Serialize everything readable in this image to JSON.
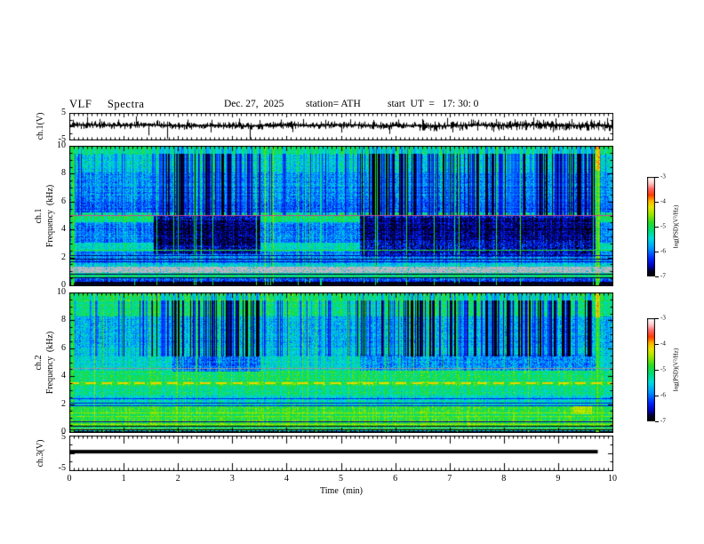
{
  "header": {
    "title": "VLF  Spectra",
    "date": "Dec. 27,  2025",
    "station": "station= ATH",
    "start_ut": "start  UT  =   17: 30: 0"
  },
  "axes": {
    "x_label": "Time  (min)",
    "x_ticks": [
      0,
      1,
      2,
      3,
      4,
      5,
      6,
      7,
      8,
      9,
      10
    ],
    "x_range": [
      0,
      10
    ],
    "wave_y_ticks": [
      5,
      -5
    ],
    "wave_y_range": [
      -5,
      5
    ],
    "spec_y_ticks": [
      10,
      8,
      6,
      4,
      2,
      0
    ],
    "spec_y_range": [
      0,
      10
    ],
    "ch1_wave_label": "ch.1(V)",
    "spec1_row_label": "ch.1",
    "spec2_row_label": "ch.2",
    "freq_label": "Frequency  (kHz)",
    "ch3_label": "ch.3(V)"
  },
  "colorbar": {
    "label": "log(PSD)(V²/Hz)",
    "ticks": [
      "-3",
      "-4",
      "-5",
      "-6",
      "-7"
    ],
    "range": [
      -3,
      -7
    ],
    "stops": [
      [
        0.0,
        "#000000"
      ],
      [
        0.05,
        "#000028"
      ],
      [
        0.1,
        "#0000b4"
      ],
      [
        0.18,
        "#0028ff"
      ],
      [
        0.28,
        "#0096ff"
      ],
      [
        0.38,
        "#00dcdc"
      ],
      [
        0.46,
        "#00dc78"
      ],
      [
        0.54,
        "#28dc28"
      ],
      [
        0.62,
        "#96e600"
      ],
      [
        0.7,
        "#e6e600"
      ],
      [
        0.76,
        "#ffb400"
      ],
      [
        0.82,
        "#ff3c00"
      ],
      [
        0.88,
        "#ff6464"
      ],
      [
        0.94,
        "#ffc8c8"
      ],
      [
        1.0,
        "#ffffff"
      ]
    ]
  },
  "chart_data": [
    {
      "type": "line",
      "name": "ch.1(V) time series",
      "x_range": [
        0,
        10
      ],
      "ylim": [
        -5,
        5
      ],
      "baseline": 0.3,
      "noise": {
        "amp": 0.55,
        "amp_late": 0.8,
        "late_t": 6.3
      },
      "spikes": [
        [
          0.06,
          2.4
        ],
        [
          0.33,
          3.5
        ],
        [
          0.55,
          2.7
        ],
        [
          0.9,
          2.5
        ],
        [
          1.22,
          3.7
        ],
        [
          1.45,
          -3.4
        ],
        [
          1.62,
          2.3
        ],
        [
          1.8,
          -4.7
        ],
        [
          2.18,
          2.5
        ],
        [
          2.6,
          -2.3
        ],
        [
          2.62,
          2.4
        ],
        [
          3.12,
          2.9
        ],
        [
          3.32,
          -4.8
        ],
        [
          3.5,
          2.3
        ],
        [
          3.9,
          2.5
        ],
        [
          4.1,
          -2.2
        ],
        [
          4.3,
          2.7
        ],
        [
          4.72,
          2.4
        ],
        [
          5.0,
          -2.4
        ],
        [
          5.18,
          2.6
        ],
        [
          5.6,
          2.3
        ],
        [
          5.9,
          -2.9
        ],
        [
          6.05,
          2.5
        ],
        [
          6.5,
          2.7
        ],
        [
          6.95,
          3.1
        ],
        [
          7.05,
          -2.3
        ],
        [
          7.4,
          2.5
        ],
        [
          7.8,
          -2.1
        ],
        [
          7.85,
          2.7
        ],
        [
          8.2,
          2.6
        ],
        [
          8.55,
          3.3
        ],
        [
          8.9,
          -2.2
        ],
        [
          8.95,
          2.9
        ],
        [
          9.25,
          2.7
        ],
        [
          9.6,
          2.5
        ],
        [
          9.9,
          3.1
        ]
      ]
    },
    {
      "type": "heatmap",
      "name": "ch.1 spectrogram",
      "xlabel": "Time (min)",
      "ylabel": "Frequency (kHz)",
      "zlabel": "log(PSD)(V²/Hz)",
      "x_range": [
        0,
        10
      ],
      "y_range": [
        0,
        10
      ],
      "z_range": [
        -7,
        -3
      ],
      "bands": [
        {
          "f": [
            9.35,
            10.01
          ],
          "level": -5.05,
          "noise": 0.28
        },
        {
          "f": [
            8.1,
            9.35
          ],
          "level": -5.45,
          "noise": 0.4
        },
        {
          "f": [
            6.2,
            8.1
          ],
          "level": -5.85,
          "noise": 0.4
        },
        {
          "f": [
            5.25,
            6.2
          ],
          "level": -6.05,
          "noise": 0.35
        },
        {
          "f": [
            4.55,
            5.25
          ],
          "level": -5.15,
          "noise": 0.3
        },
        {
          "f": [
            3.1,
            4.55
          ],
          "level": -5.95,
          "noise": 0.35
        },
        {
          "f": [
            2.5,
            3.1
          ],
          "level": -5.4,
          "noise": 0.3
        },
        {
          "f": [
            1.65,
            2.5
          ],
          "level": -5.95,
          "noise": 0.35
        },
        {
          "f": [
            1.42,
            1.65
          ],
          "level": -5.55,
          "noise": 0.3
        },
        {
          "f": [
            0.95,
            1.42
          ],
          "level": -5.5,
          "noise": 0.3,
          "rgb": [
            176,
            182,
            192
          ],
          "jitter": 26,
          "speckle": 0.12
        },
        {
          "f": [
            0.6,
            0.95
          ],
          "level": -5.35,
          "noise": 0.35
        },
        {
          "f": [
            0.3,
            0.6
          ],
          "level": -6.2,
          "noise": 0.4
        },
        {
          "f": [
            0,
            0.3
          ],
          "level": -6.9,
          "noise": 0.15
        }
      ],
      "stripes": [
        {
          "f": 5.02,
          "w": 0.09,
          "rgb": [
            205,
            70,
            150
          ]
        },
        {
          "f": 2.54,
          "w": 0.08,
          "level": -4.9
        },
        {
          "f": 2.2,
          "w": 0.05,
          "level": -6.6
        },
        {
          "f": 1.95,
          "w": 0.05,
          "level": -6.7
        },
        {
          "f": 1.75,
          "w": 0.05,
          "level": -6.5
        },
        {
          "f": 0.88,
          "w": 0.06,
          "level": -6.8
        },
        {
          "f": 0.74,
          "w": 0.06,
          "level": -5.0
        },
        {
          "f": 0.62,
          "w": 0.05,
          "level": -6.9
        },
        {
          "f": 0.5,
          "w": 0.05,
          "level": -5.2
        },
        {
          "f": 0.38,
          "w": 0.05,
          "level": -6.9
        }
      ],
      "blocks": [
        {
          "t": [
            1.55,
            3.52
          ],
          "f": [
            2.3,
            5.0
          ],
          "level": -6.55,
          "noise": 0.45
        },
        {
          "t": [
            1.55,
            3.52
          ],
          "f": [
            2.9,
            4.7
          ],
          "level": -6.75,
          "noise": 0.35
        },
        {
          "t": [
            5.35,
            9.72
          ],
          "f": [
            2.1,
            5.0
          ],
          "level": -6.5,
          "noise": 0.45
        },
        {
          "t": [
            5.35,
            9.72
          ],
          "f": [
            3.3,
            4.9
          ],
          "level": -6.7,
          "noise": 0.35
        }
      ],
      "dark_streaks": {
        "intervals": [
          [
            1.55,
            3.52
          ],
          [
            5.35,
            9.72
          ]
        ],
        "fmin": 5.0,
        "density_active": 0.5,
        "density_quiet": 0.3
      },
      "bright_streaks": {
        "density": 0.045,
        "special": [
          {
            "t": 0.04,
            "w": 0.06
          },
          {
            "t": 9.68,
            "w": 0.08,
            "red_top": true
          }
        ]
      }
    },
    {
      "type": "heatmap",
      "name": "ch.2 spectrogram",
      "xlabel": "Time (min)",
      "ylabel": "Frequency (kHz)",
      "zlabel": "log(PSD)(V²/Hz)",
      "x_range": [
        0,
        10
      ],
      "y_range": [
        0,
        10
      ],
      "z_range": [
        -7,
        -3
      ],
      "bands": [
        {
          "f": [
            9.35,
            10.01
          ],
          "level": -4.95,
          "noise": 0.3
        },
        {
          "f": [
            8.3,
            9.35
          ],
          "level": -5.15,
          "noise": 0.3
        },
        {
          "f": [
            6.1,
            8.3
          ],
          "level": -5.7,
          "noise": 0.4
        },
        {
          "f": [
            5.45,
            6.1
          ],
          "level": -5.55,
          "noise": 0.35
        },
        {
          "f": [
            4.45,
            5.45
          ],
          "level": -5.45,
          "noise": 0.3
        },
        {
          "f": [
            3.7,
            4.45
          ],
          "level": -5.1,
          "noise": 0.3
        },
        {
          "f": [
            3.38,
            3.7
          ],
          "level": -4.85,
          "noise": 0.3
        },
        {
          "f": [
            2.65,
            3.38
          ],
          "level": -5.2,
          "noise": 0.3
        },
        {
          "f": [
            2.3,
            2.65
          ],
          "level": -5.55,
          "noise": 0.3
        },
        {
          "f": [
            1.9,
            2.3
          ],
          "level": -5.35,
          "noise": 0.35
        },
        {
          "f": [
            0.95,
            1.9
          ],
          "level": -4.95,
          "noise": 0.3
        },
        {
          "f": [
            0.4,
            0.95
          ],
          "level": -4.8,
          "noise": 0.28
        },
        {
          "f": [
            0.12,
            0.4
          ],
          "level": -5.5,
          "noise": 0.4
        },
        {
          "f": [
            0,
            0.12
          ],
          "level": -6.9,
          "noise": 0.15
        }
      ],
      "stripes": [
        {
          "f": 3.52,
          "w": 0.13,
          "level": -4.15,
          "dash": [
            0.3,
            0.62
          ]
        },
        {
          "f": 4.6,
          "w": 0.06,
          "rgb": [
            150,
            150,
            155
          ]
        },
        {
          "f": 2.42,
          "w": 0.06,
          "level": -6.3
        },
        {
          "f": 2.1,
          "w": 0.06,
          "level": -6.4
        },
        {
          "f": 1.95,
          "w": 0.05,
          "level": -6.3
        },
        {
          "f": 1.45,
          "w": 0.06,
          "level": -4.55
        },
        {
          "f": 1.15,
          "w": 0.05,
          "level": -4.6
        },
        {
          "f": 0.78,
          "w": 0.05,
          "level": -6.6
        },
        {
          "f": 0.62,
          "w": 0.05,
          "level": -4.5
        },
        {
          "f": 0.46,
          "w": 0.05,
          "level": -6.9
        },
        {
          "f": 0.3,
          "w": 0.05,
          "level": -4.7
        },
        {
          "f": 0.2,
          "w": 0.05,
          "level": -6.9
        }
      ],
      "blocks": [
        {
          "t": [
            1.9,
            3.52
          ],
          "f": [
            4.35,
            5.45
          ],
          "level": -6.0,
          "noise": 0.4
        },
        {
          "t": [
            5.35,
            9.72
          ],
          "f": [
            4.45,
            5.6
          ],
          "level": -5.85,
          "noise": 0.4
        },
        {
          "t": [
            9.25,
            9.6
          ],
          "f": [
            1.3,
            1.9
          ],
          "level": -4.4,
          "noise": 0.25
        }
      ],
      "dark_streaks": {
        "intervals": [
          [
            1.5,
            3.52
          ],
          [
            5.3,
            9.72
          ]
        ],
        "fmin": 5.45,
        "density_active": 0.45,
        "density_quiet": 0.22
      },
      "bright_streaks": {
        "density": 0.05,
        "special": [
          {
            "t": 0.04,
            "w": 0.06
          },
          {
            "t": 9.68,
            "w": 0.08,
            "red_top": true
          }
        ]
      }
    },
    {
      "type": "line",
      "name": "ch.3(V) time series",
      "x_range": [
        0,
        10
      ],
      "ylim": [
        -5,
        5
      ],
      "segments": [
        {
          "t": [
            0,
            9.73
          ],
          "value": 0.35,
          "thickness_px": 4
        }
      ]
    }
  ]
}
